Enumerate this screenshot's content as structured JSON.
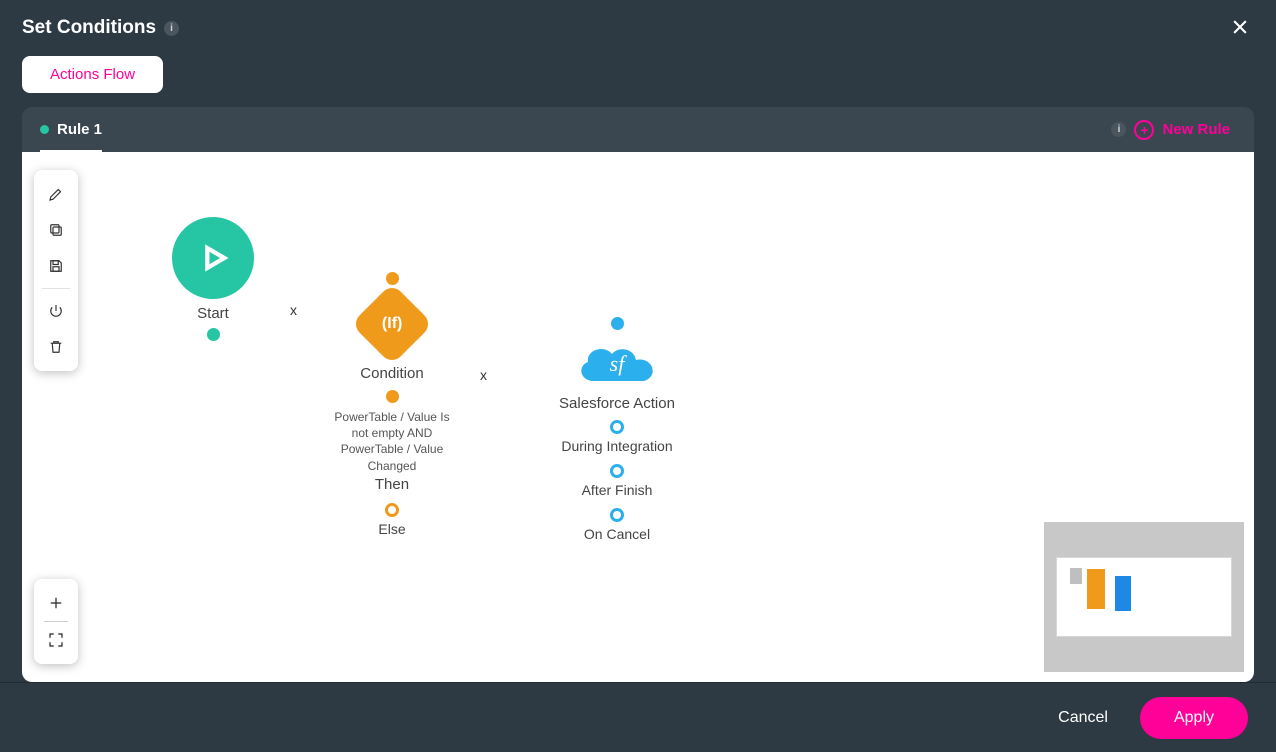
{
  "header": {
    "title": "Set Conditions",
    "info_badge": "i"
  },
  "tabs": {
    "actions_flow": "Actions Flow"
  },
  "rulebar": {
    "active_rule": "Rule 1",
    "new_rule_info": "i",
    "new_rule_label": "New Rule"
  },
  "nodes": {
    "start": {
      "label": "Start"
    },
    "condition": {
      "label": "Condition",
      "diamond_text": "(If)",
      "description": "PowerTable / Value Is not empty AND PowerTable / Value Changed",
      "then_label": "Then",
      "else_label": "Else"
    },
    "salesforce": {
      "label": "Salesforce Action",
      "cloud_text": "sf",
      "ports": {
        "during": "During Integration",
        "after": "After Finish",
        "cancel": "On Cancel"
      }
    }
  },
  "edges": {
    "x_label": "x"
  },
  "footer": {
    "cancel": "Cancel",
    "apply": "Apply"
  }
}
